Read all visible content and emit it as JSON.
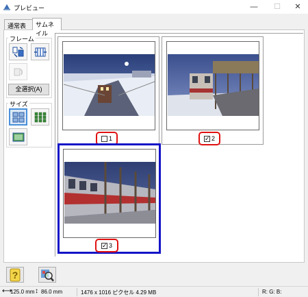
{
  "window": {
    "title": "プレビュー",
    "icon": "scanner-app-icon",
    "minimize_glyph": "—",
    "maximize_glyph": "☐",
    "close_glyph": "✕"
  },
  "tabs": [
    {
      "label": "通常表示",
      "active": false
    },
    {
      "label": "サムネイル",
      "active": true
    }
  ],
  "frame_group": {
    "label": "フレーム",
    "select_all_label": "全選択(A)",
    "icons": [
      "frame-auto-locate-icon",
      "frame-adjust-icon",
      "frame-rotate-icon"
    ]
  },
  "size_group": {
    "label": "サイズ",
    "icons": [
      "large-thumbnail-icon",
      "medium-thumbnail-icon",
      "small-thumbnail-icon"
    ]
  },
  "thumbnails": [
    {
      "number": "1",
      "checked": false,
      "selected": false,
      "box": "□",
      "tick": ""
    },
    {
      "number": "2",
      "checked": true,
      "selected": false,
      "box": "□",
      "tick": "✓"
    },
    {
      "number": "3",
      "checked": true,
      "selected": true,
      "box": "□",
      "tick": "✓"
    }
  ],
  "bottom_buttons": [
    "help-icon",
    "zoom-preview-icon"
  ],
  "help_glyph": "?",
  "status": {
    "width": "125.0 mm",
    "height": "86.0 mm",
    "pixels": "1476 x 1016 ピクセル 4.29 MB",
    "rgb": "R:  G:  B:"
  },
  "colors": {
    "accent": "#1414c8",
    "highlight": "#e01010",
    "active_tool": "#4a90d9"
  }
}
